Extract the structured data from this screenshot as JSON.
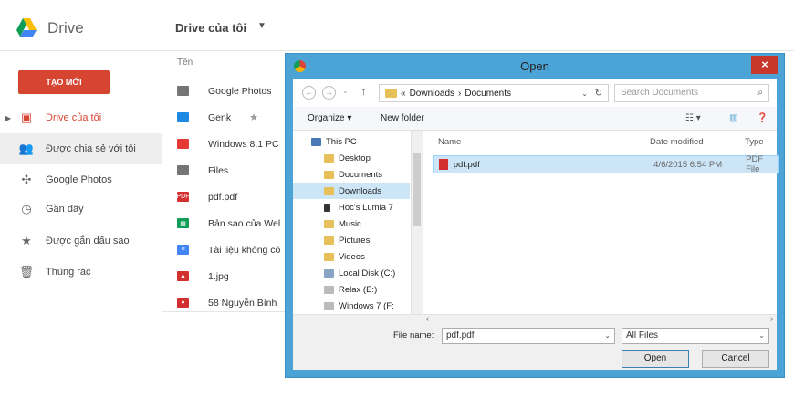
{
  "app": {
    "name": "Drive"
  },
  "header": {
    "breadcrumb": "Drive của tôi",
    "dropdown_icon": "caret-down-icon"
  },
  "sidebar": {
    "new_button": "TẠO MỚI",
    "items": [
      {
        "label": "Drive của tôi",
        "icon": "drive-icon",
        "active": true
      },
      {
        "label": "Được chia sẻ với tôi",
        "icon": "shared-icon"
      },
      {
        "label": "Google Photos",
        "icon": "photos-icon"
      },
      {
        "label": "Gần đây",
        "icon": "clock-icon"
      },
      {
        "label": "Được gắn dấu sao",
        "icon": "star-icon"
      },
      {
        "label": "Thùng rác",
        "icon": "trash-icon"
      }
    ]
  },
  "file_list": {
    "column_name": "Tên",
    "files": [
      {
        "name": "Google Photos",
        "type": "folder-gray",
        "color": "#757575"
      },
      {
        "name": "Genk",
        "type": "folder-blue",
        "color": "#1e88e5",
        "starred": true
      },
      {
        "name": "Windows 8.1 PC",
        "type": "folder-red",
        "color": "#e53935"
      },
      {
        "name": "Files",
        "type": "folder-gray",
        "color": "#757575"
      },
      {
        "name": "pdf.pdf",
        "type": "pdf",
        "color": "#d32f2f"
      },
      {
        "name": "Bản sao của Wel",
        "type": "sheet",
        "color": "#0f9d58"
      },
      {
        "name": "Tài liệu không có",
        "type": "doc",
        "color": "#4285f4"
      },
      {
        "name": "1.jpg",
        "type": "image",
        "color": "#d32f2f"
      },
      {
        "name": "58 Nguyễn Bình",
        "type": "map",
        "color": "#d32f2f"
      }
    ]
  },
  "dialog": {
    "title": "Open",
    "close": "×",
    "address": [
      "«",
      "Downloads",
      "›",
      "Documents"
    ],
    "search_placeholder": "Search Documents",
    "organize": "Organize ▾",
    "new_folder": "New folder",
    "tree": [
      {
        "label": "This PC",
        "icon": "pc-icon"
      },
      {
        "label": "Desktop",
        "icon": "folder-icon"
      },
      {
        "label": "Documents",
        "icon": "folder-icon"
      },
      {
        "label": "Downloads",
        "icon": "folder-icon",
        "selected": true
      },
      {
        "label": "Hoc's Lumia 7",
        "icon": "phone-icon"
      },
      {
        "label": "Music",
        "icon": "folder-icon"
      },
      {
        "label": "Pictures",
        "icon": "folder-icon"
      },
      {
        "label": "Videos",
        "icon": "folder-icon"
      },
      {
        "label": "Local Disk (C:)",
        "icon": "disk-icon"
      },
      {
        "label": "Relax (E:)",
        "icon": "disk-icon"
      },
      {
        "label": "Windows 7 (F:",
        "icon": "disk-icon"
      }
    ],
    "columns": {
      "name": "Name",
      "date": "Date modified",
      "type": "Type"
    },
    "rows": [
      {
        "name": "pdf.pdf",
        "date": "4/6/2015 6:54 PM",
        "type": "PDF File"
      }
    ],
    "file_name_label": "File name:",
    "file_name_value": "pdf.pdf",
    "file_type": "All Files",
    "open_button": "Open",
    "cancel_button": "Cancel"
  }
}
